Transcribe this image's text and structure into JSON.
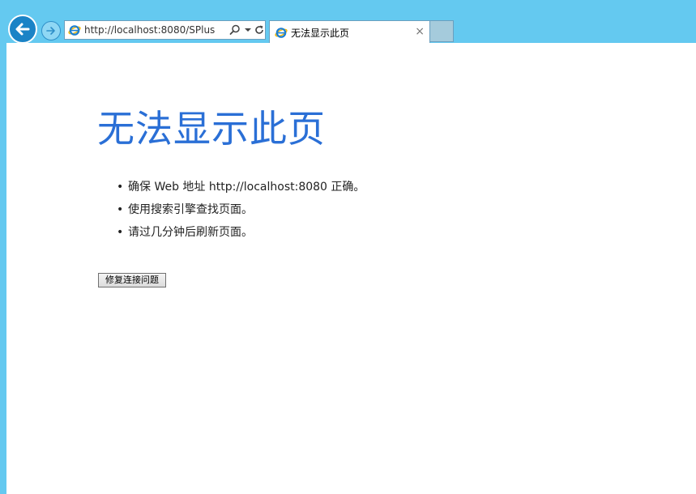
{
  "browser": {
    "address": "http://localhost:8080/SPlus",
    "tab_title": "无法显示此页",
    "tab_close": "×"
  },
  "page": {
    "heading": "无法显示此页",
    "bullet": "•",
    "tips": [
      "确保 Web 地址 http://localhost:8080 正确。",
      "使用搜索引擎查找页面。",
      "请过几分钟后刷新页面。"
    ],
    "fix_button": "修复连接问题"
  },
  "colors": {
    "frame": "#64c9f0",
    "heading": "#2a6fd6",
    "back_button": "#1a83c6"
  }
}
